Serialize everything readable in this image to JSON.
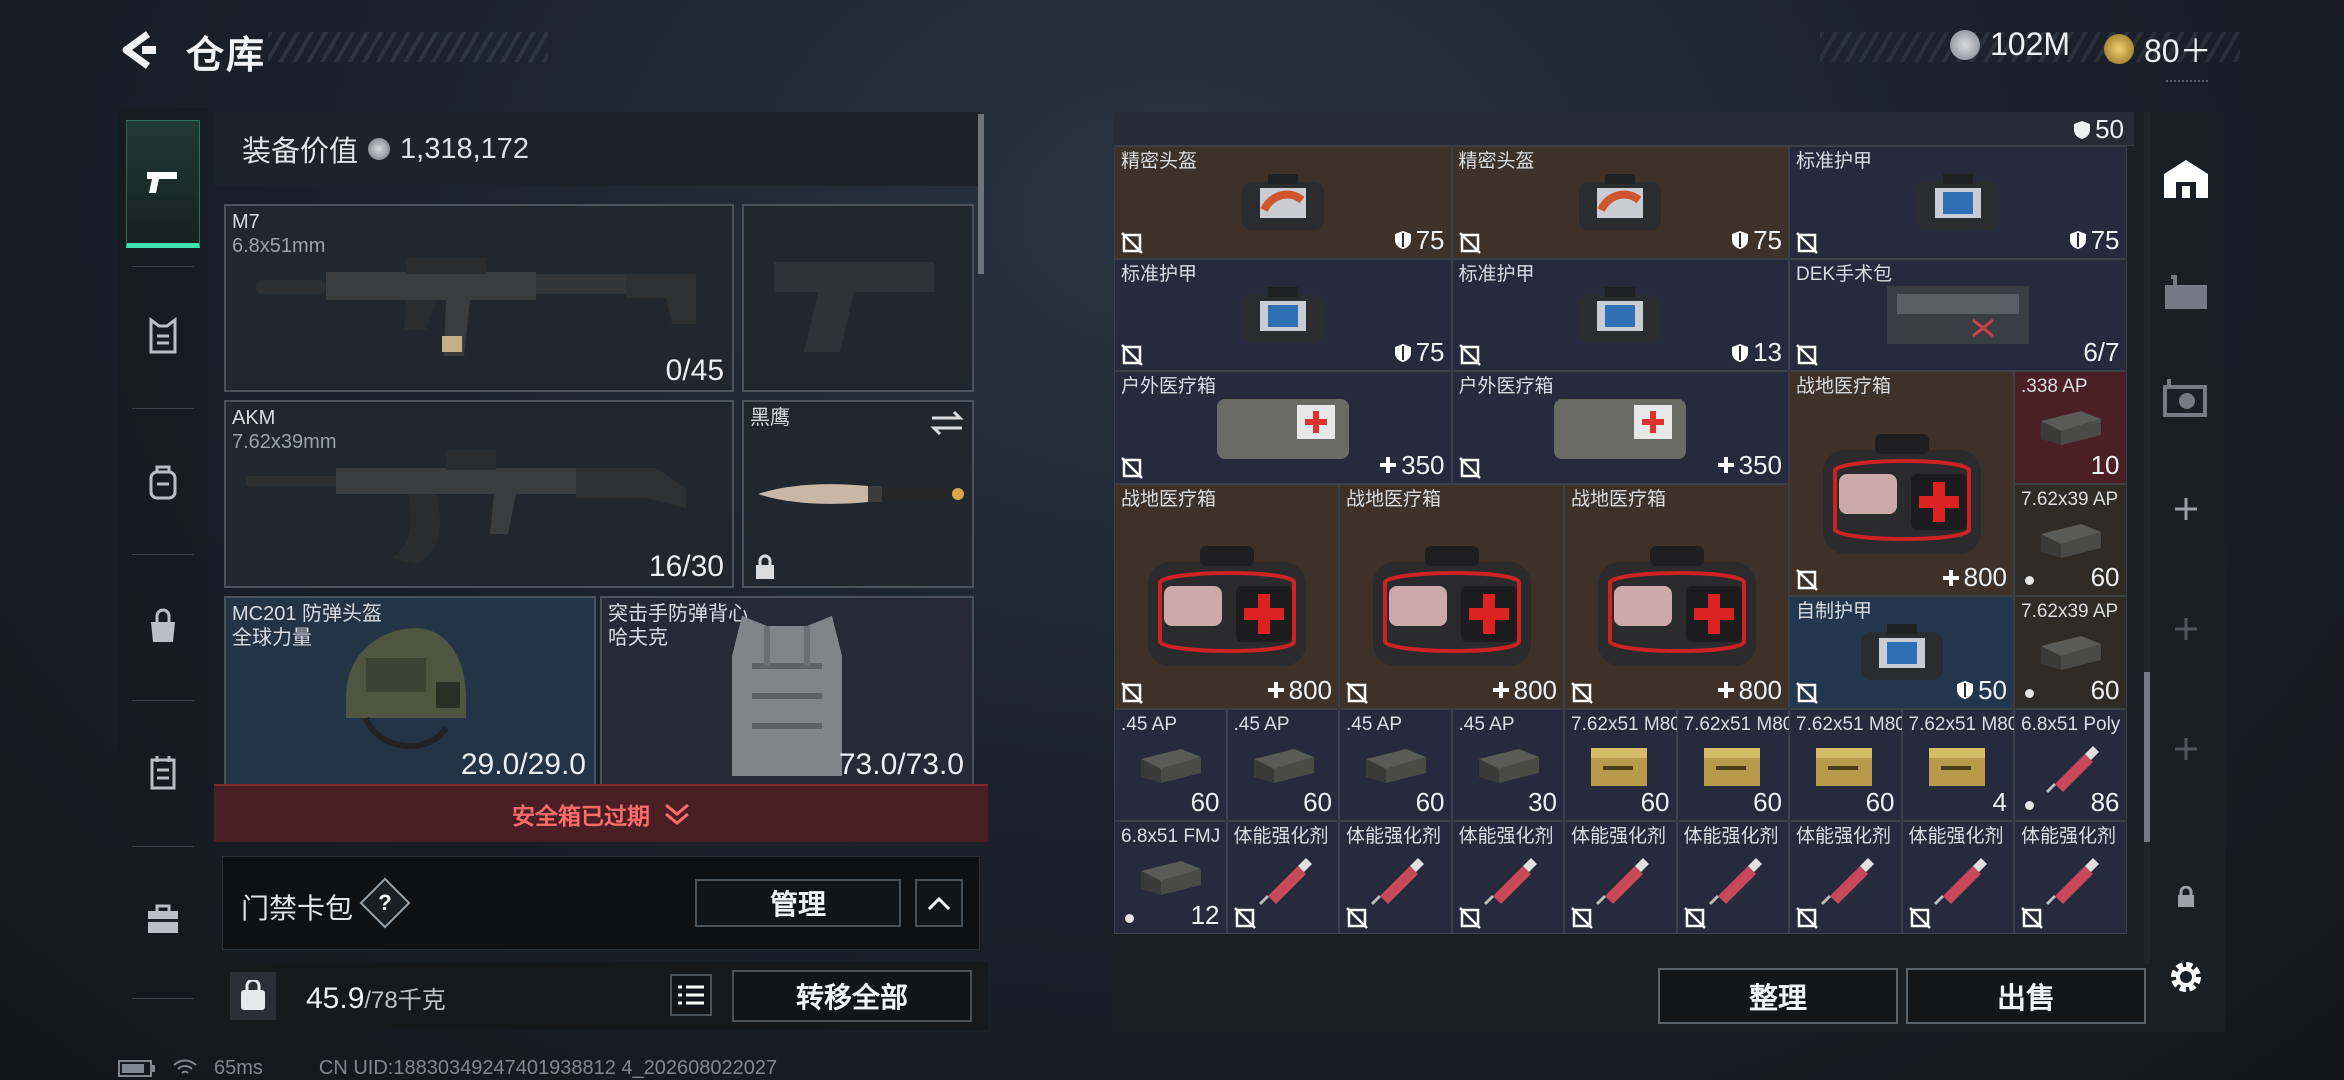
{
  "header": {
    "title": "仓库",
    "currency1": "102M",
    "currency2": "80＋"
  },
  "equipment": {
    "value_label": "装备价值",
    "value": "1,318,172",
    "primary": {
      "name": "M7",
      "caliber": "6.8x51mm",
      "ammo": "0/45"
    },
    "secondary": {
      "name": "AKM",
      "caliber": "7.62x39mm",
      "ammo": "16/30"
    },
    "melee": {
      "name": "黑鹰"
    },
    "helmet": {
      "name": "MC201 防弹头盔",
      "brand": "全球力量",
      "durability": "29.0/29.0"
    },
    "armor": {
      "name": "突击手防弹背心",
      "brand": "哈夫克",
      "durability": "73.0/73.0"
    }
  },
  "safebox": {
    "label": "安全箱已过期"
  },
  "keycard": {
    "label": "门禁卡包",
    "help": "?",
    "manage": "管理"
  },
  "weight": {
    "current": "45.9",
    "max": "/78千克",
    "transfer": "转移全部"
  },
  "inventory": {
    "top_value": "50",
    "items": [
      {
        "name": "精密头盔",
        "value": "75"
      },
      {
        "name": "精密头盔",
        "value": "75"
      },
      {
        "name": "标准护甲",
        "value": "75"
      },
      {
        "name": "标准护甲",
        "value": "75"
      },
      {
        "name": "标准护甲",
        "value": "13"
      },
      {
        "name": "DEK手术包",
        "value": "6/7"
      },
      {
        "name": "户外医疗箱",
        "value": "350"
      },
      {
        "name": "户外医疗箱",
        "value": "350"
      },
      {
        "name": "战地医疗箱",
        "value": "800"
      },
      {
        "name": ".338 AP",
        "value": "10"
      },
      {
        "name": "战地医疗箱",
        "value": "800"
      },
      {
        "name": "战地医疗箱",
        "value": "800"
      },
      {
        "name": "战地医疗箱",
        "value": "800"
      },
      {
        "name": "7.62x39 AP",
        "value": "60"
      },
      {
        "name": "自制护甲",
        "value": "50"
      },
      {
        "name": "7.62x39 AP",
        "value": "60"
      },
      {
        "name": ".45 AP",
        "value": "60"
      },
      {
        "name": ".45 AP",
        "value": "60"
      },
      {
        "name": ".45 AP",
        "value": "60"
      },
      {
        "name": ".45 AP",
        "value": "30"
      },
      {
        "name": "7.62x51 M80",
        "value": "60"
      },
      {
        "name": "7.62x51 M80",
        "value": "60"
      },
      {
        "name": "7.62x51 M80",
        "value": "60"
      },
      {
        "name": "7.62x51 M80",
        "value": "4"
      },
      {
        "name": "6.8x51 Poly",
        "value": "86"
      },
      {
        "name": "6.8x51 FMJ",
        "value": "12"
      },
      {
        "name": "体能强化剂",
        "value": ""
      },
      {
        "name": "体能强化剂",
        "value": ""
      },
      {
        "name": "体能强化剂",
        "value": ""
      },
      {
        "name": "体能强化剂",
        "value": ""
      },
      {
        "name": "体能强化剂",
        "value": ""
      },
      {
        "name": "体能强化剂",
        "value": ""
      },
      {
        "name": "体能强化剂",
        "value": ""
      },
      {
        "name": "体能强化剂",
        "value": ""
      }
    ],
    "sort": "整理",
    "sell": "出售"
  },
  "status": {
    "ping": "65ms",
    "uid": "CN UID:18830349247401938812 4_202608022027"
  },
  "colors": {
    "accent": "#3ee3b0",
    "alert": "#ff6b6b"
  }
}
